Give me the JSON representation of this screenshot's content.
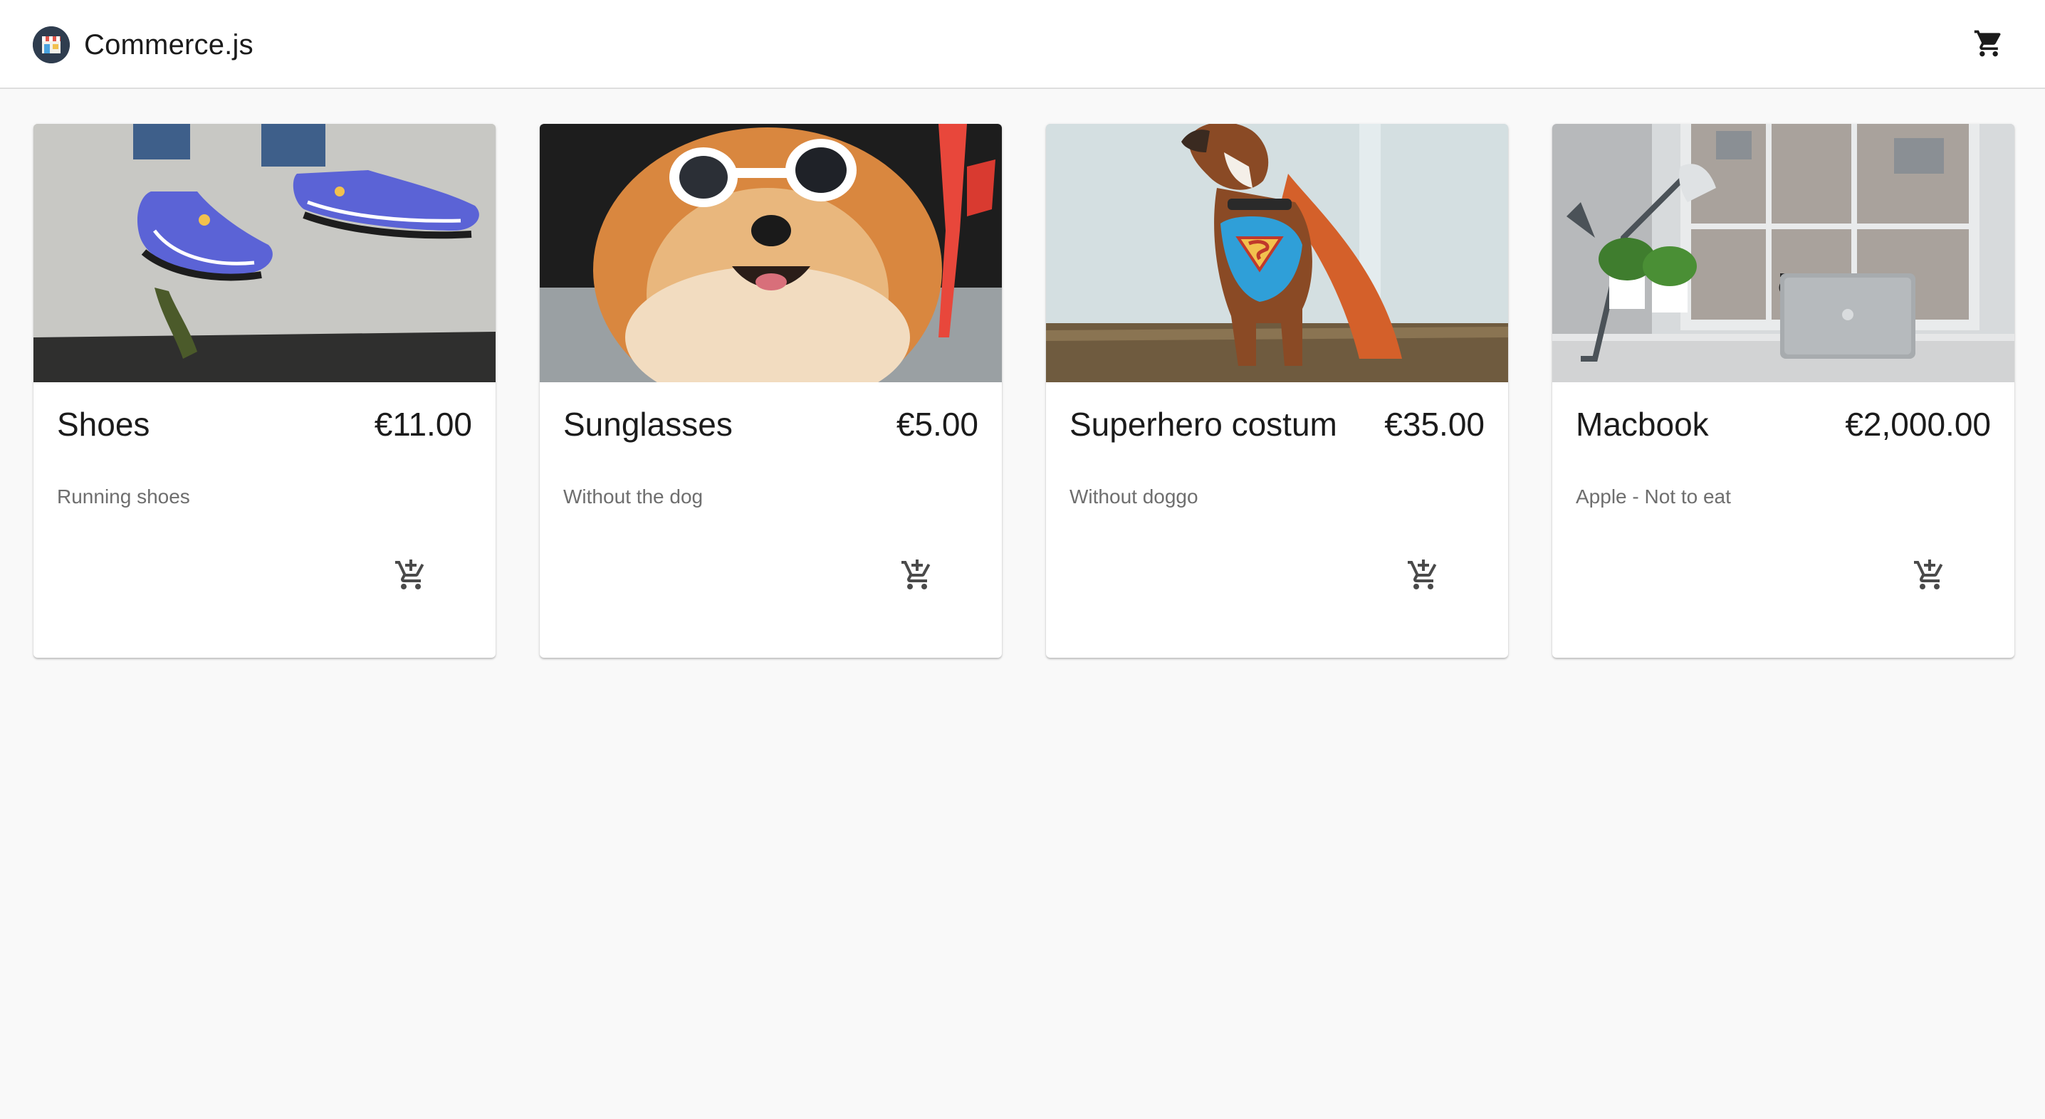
{
  "appbar": {
    "title": "Commerce.js",
    "logo_icon": "store-icon",
    "cart_icon": "shopping-cart-icon"
  },
  "products": [
    {
      "name": "Shoes",
      "price": "€11.00",
      "description": "Running shoes",
      "image": "sneakers-photo",
      "add_icon": "add-shopping-cart-icon"
    },
    {
      "name": "Sunglasses",
      "price": "€5.00",
      "description": "Without the dog",
      "image": "dog-sunglasses-photo",
      "add_icon": "add-shopping-cart-icon"
    },
    {
      "name": "Superhero costum",
      "price": "€35.00",
      "description": "Without doggo",
      "image": "dog-superhero-costume-photo",
      "add_icon": "add-shopping-cart-icon"
    },
    {
      "name": "Macbook",
      "price": "€2,000.00",
      "description": "Apple - Not to eat",
      "image": "macbook-desk-photo",
      "add_icon": "add-shopping-cart-icon"
    }
  ],
  "colors": {
    "background": "#f9f9f9",
    "appbar": "#ffffff",
    "text": "#1b1b1b",
    "muted_text": "#6e6e6e",
    "icon": "#4a4a4a"
  }
}
